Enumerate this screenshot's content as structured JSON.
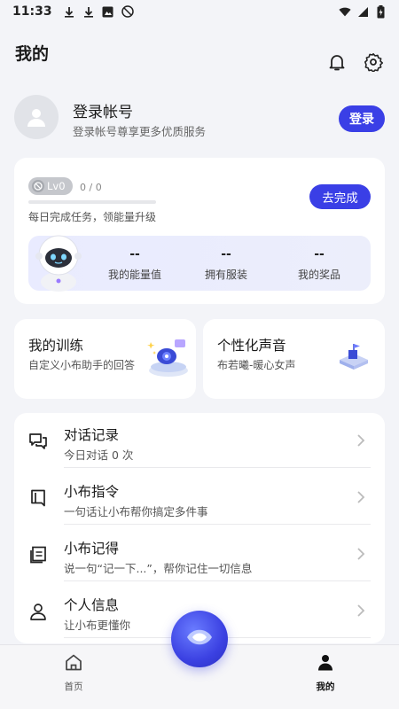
{
  "status_bar": {
    "time": "11:33",
    "icons_left": [
      "download-icon",
      "download-icon",
      "photo-icon",
      "no-disturb-icon"
    ],
    "icons_right": [
      "wifi-icon",
      "signal-icon",
      "battery-icon"
    ]
  },
  "header": {
    "title": "我的",
    "icons": [
      "bell-icon",
      "gear-icon"
    ]
  },
  "profile": {
    "name": "登录帐号",
    "subtitle": "登录帐号尊享更多优质服务",
    "login_label": "登录"
  },
  "level": {
    "badge": "Lv0",
    "progress_text": "0 / 0",
    "progress_fraction": 0,
    "description": "每日完成任务，领能量升级",
    "action_label": "去完成",
    "stats": [
      {
        "value": "--",
        "label": "我的能量值"
      },
      {
        "value": "--",
        "label": "拥有服装"
      },
      {
        "value": "--",
        "label": "我的奖品"
      }
    ]
  },
  "features": [
    {
      "title": "我的训练",
      "subtitle": "自定义小布助手的回答"
    },
    {
      "title": "个性化声音",
      "subtitle": "布若曦-暖心女声"
    }
  ],
  "list": [
    {
      "title": "对话记录",
      "subtitle": "今日对话 0 次",
      "icon": "chat-icon"
    },
    {
      "title": "小布指令",
      "subtitle": "一句话让小布帮你搞定多件事",
      "icon": "bookmark-icon"
    },
    {
      "title": "小布记得",
      "subtitle": "说一句“记一下...”，帮你记住一切信息",
      "icon": "notes-icon"
    },
    {
      "title": "个人信息",
      "subtitle": "让小布更懂你",
      "icon": "person-icon"
    }
  ],
  "nav": {
    "home_label": "首页",
    "mine_label": "我的"
  },
  "colors": {
    "accent": "#3a3fe6",
    "background": "#f3f4f8"
  }
}
